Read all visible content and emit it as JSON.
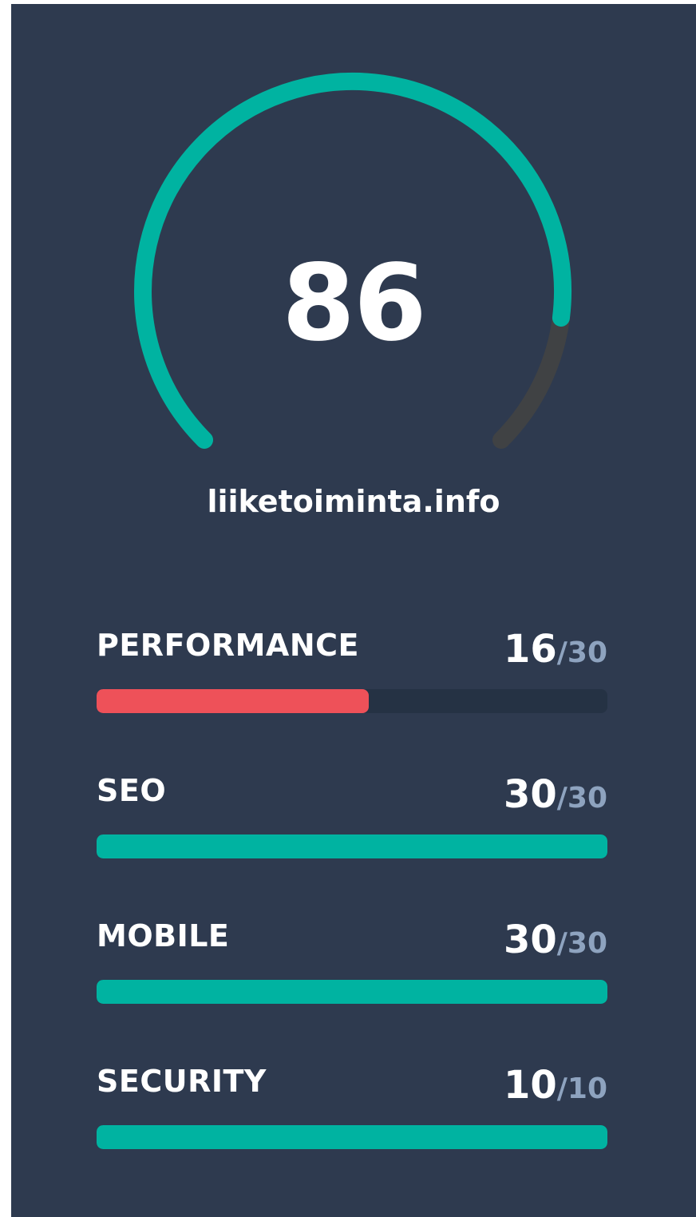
{
  "score": {
    "value": "86",
    "fraction": 0.86,
    "color": "#00b3a1",
    "track_color": "#404244"
  },
  "site": {
    "domain": "liiketoiminta.info"
  },
  "metrics": [
    {
      "label": "PERFORMANCE",
      "value": "16",
      "max": "/30",
      "fraction": 0.5333,
      "color": "#ee5159"
    },
    {
      "label": "SEO",
      "value": "30",
      "max": "/30",
      "fraction": 1.0,
      "color": "#00b3a1"
    },
    {
      "label": "MOBILE",
      "value": "30",
      "max": "/30",
      "fraction": 1.0,
      "color": "#00b3a1"
    },
    {
      "label": "SECURITY",
      "value": "10",
      "max": "/10",
      "fraction": 1.0,
      "color": "#00b3a1"
    }
  ],
  "colors": {
    "background": "#2e3a4f",
    "bar_track": "#253244",
    "muted_text": "#8ea3bf"
  }
}
